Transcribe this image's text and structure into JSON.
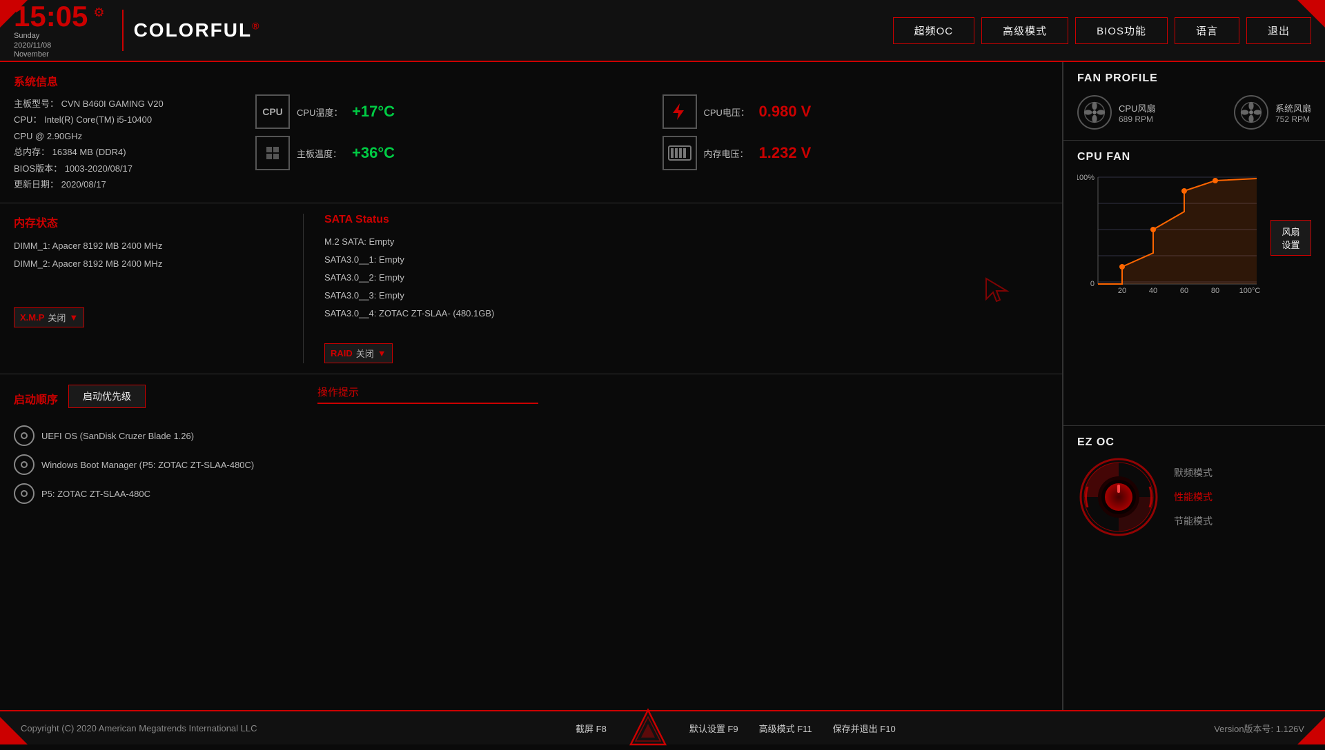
{
  "header": {
    "time": "15:05",
    "day": "Sunday",
    "date": "2020/11/08",
    "month": "November",
    "brand": "COLORFUL",
    "brand_reg": "®",
    "nav": [
      {
        "label": "超频OC"
      },
      {
        "label": "高级模式"
      },
      {
        "label": "BIOS功能"
      },
      {
        "label": "语言"
      },
      {
        "label": "退出"
      }
    ]
  },
  "sys_info": {
    "title": "系统信息",
    "mb_model_label": "主板型号：",
    "mb_model": "CVN B460I GAMING V20",
    "cpu_label": "CPU：",
    "cpu": " Intel(R) Core(TM) i5-10400",
    "cpu2": " CPU @ 2.90GHz",
    "mem_label": "总内存：",
    "mem": " 16384 MB (DDR4)",
    "bios_label": "BIOS版本：",
    "bios": " 1003-2020/08/17",
    "update_label": "更新日期：",
    "update": " 2020/08/17"
  },
  "temps": {
    "cpu_temp_label": "CPU温度：",
    "cpu_temp": "+17°C",
    "mb_temp_label": "主板温度：",
    "mb_temp": "+36°C"
  },
  "voltages": {
    "cpu_volt_label": "CPU电压：",
    "cpu_volt": "0.980 V",
    "mem_volt_label": "内存电压：",
    "mem_volt": "1.232 V"
  },
  "memory": {
    "title": "内存状态",
    "dimm1": "DIMM_1: Apacer 8192 MB 2400 MHz",
    "dimm2": "DIMM_2: Apacer 8192 MB 2400 MHz",
    "xmp_label": "X.M.P",
    "xmp_value": "关闭"
  },
  "sata": {
    "title": "SATA Status",
    "m2": "M.2 SATA: Empty",
    "s1": "SATA3.0__1: Empty",
    "s2": "SATA3.0__2: Empty",
    "s3": "SATA3.0__3: Empty",
    "s4": "SATA3.0__4: ZOTAC ZT-SLAA- (480.1GB)",
    "raid_label": "RAID",
    "raid_value": "关闭"
  },
  "boot": {
    "title": "启动顺序",
    "priority_btn": "启动优先级",
    "items": [
      "UEFI OS (SanDisk Cruzer Blade 1.26)",
      "Windows Boot Manager (P5: ZOTAC ZT-SLAA-480C)",
      "P5: ZOTAC ZT-SLAA-480C"
    ],
    "op_hint_title": "操作提示"
  },
  "fan_profile": {
    "title": "FAN PROFILE",
    "cpu_fan": "CPU风扇",
    "cpu_rpm": "689 RPM",
    "sys_fan": "系统风扇",
    "sys_rpm": "752 RPM"
  },
  "cpu_fan_chart": {
    "title": "CPU FAN",
    "y_max": "100%",
    "y_min": "0",
    "x_labels": [
      "20",
      "40",
      "60",
      "80",
      "100°C"
    ],
    "fan_btn": "风扇设置"
  },
  "ez_oc": {
    "title": "EZ OC",
    "modes": [
      {
        "label": "默频模式",
        "active": false
      },
      {
        "label": "性能模式",
        "active": true
      },
      {
        "label": "节能模式",
        "active": false
      }
    ]
  },
  "footer": {
    "copyright": "Copyright (C) 2020 American Megatrends International LLC",
    "keys": [
      {
        "key": "截屏 F8"
      },
      {
        "key": "默认设置 F9"
      },
      {
        "key": "高级模式 F11"
      },
      {
        "key": "保存并退出 F10"
      }
    ],
    "version": "Version版本号: 1.126V"
  }
}
